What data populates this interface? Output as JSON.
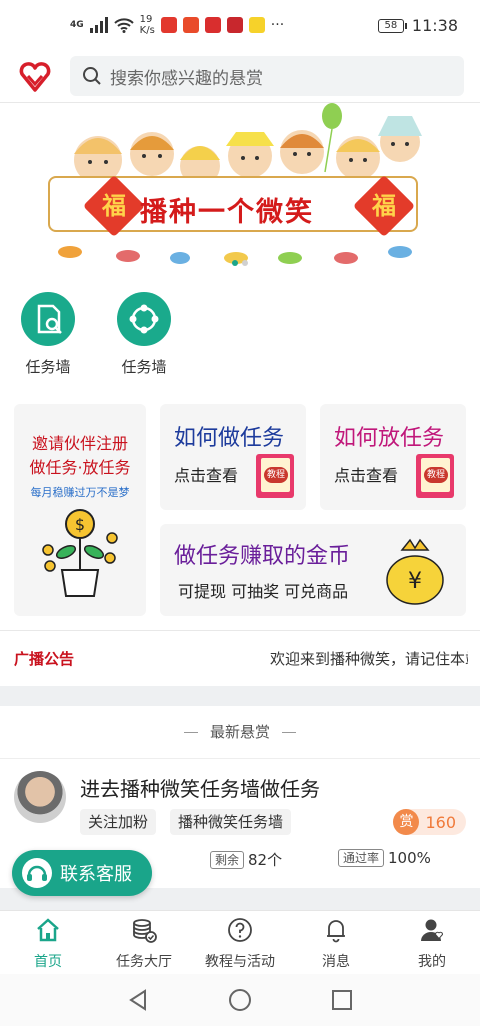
{
  "status_bar": {
    "network": "4G",
    "speed_value": "19",
    "speed_unit": "K/s",
    "more": "···",
    "battery": "58",
    "time": "11:38"
  },
  "search": {
    "placeholder": "搜索你感兴趣的悬赏",
    "icon": "search-icon"
  },
  "banner": {
    "slogan": "播种一个微笑",
    "fu_char": "福",
    "active_dot": 1,
    "dots": 2
  },
  "quick_links": [
    {
      "label": "任务墙",
      "icon": "document-search-icon"
    },
    {
      "label": "任务墙",
      "icon": "network-nodes-icon"
    }
  ],
  "cards": {
    "invite": {
      "line1": "邀请伙伴注册",
      "line2": "做任务·放任务",
      "sub": "每月稳赚过万不是梦",
      "icon": "money-plant-icon"
    },
    "how_do": {
      "title": "如何做任务",
      "sub": "点击查看",
      "book_tag": "教程"
    },
    "how_post": {
      "title": "如何放任务",
      "sub": "点击查看",
      "book_tag": "教程"
    },
    "coins": {
      "title": "做任务赚取的金币",
      "sub": "可提现 可抽奖 可兑商品",
      "bag_symbol": "¥"
    }
  },
  "broadcast": {
    "label": "广播公告",
    "text": "欢迎来到播种微笑，请记住本站"
  },
  "latest": {
    "heading": "最新悬赏",
    "task": {
      "title": "进去播种微笑任务墙做任务",
      "tags": [
        "关注加粉",
        "播种微笑任务墙"
      ],
      "reward_badge": "赏",
      "reward": "160",
      "remaining_label": "剩余",
      "remaining": "82个",
      "pass_rate_label": "通过率",
      "pass_rate": "100%"
    }
  },
  "customer_service": {
    "label": "联系客服"
  },
  "bottom_nav": [
    {
      "label": "首页",
      "icon": "home-icon",
      "active": true
    },
    {
      "label": "任务大厅",
      "icon": "coins-stack-icon",
      "active": false
    },
    {
      "label": "教程与活动",
      "icon": "question-circle-icon",
      "active": false
    },
    {
      "label": "消息",
      "icon": "bell-icon",
      "active": false
    },
    {
      "label": "我的",
      "icon": "user-icon",
      "active": false
    }
  ],
  "colors": {
    "accent": "#1aa58a",
    "red": "#c9121e",
    "blue": "#1d3b9c",
    "pink": "#c0177a",
    "purple": "#6a1f9a",
    "orange": "#f07a3a"
  }
}
